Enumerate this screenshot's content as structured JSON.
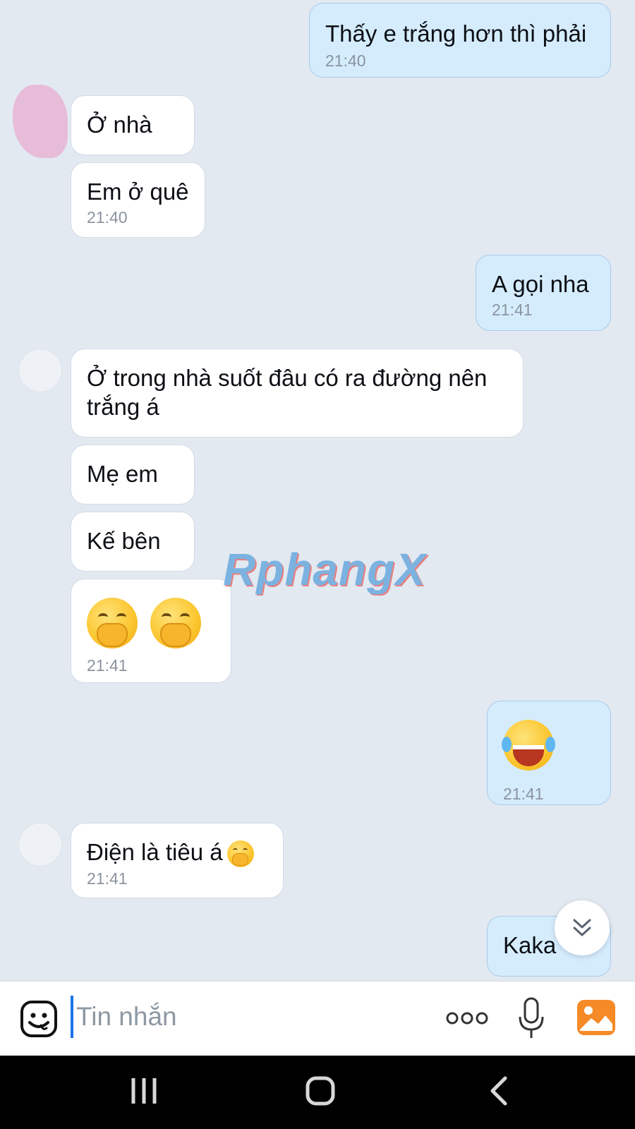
{
  "messages": [
    {
      "side": "out",
      "text": "Thấy e trắng hơn thì phải",
      "time": "21:40"
    },
    {
      "side": "in",
      "text": "Ở nhà",
      "time": ""
    },
    {
      "side": "in",
      "text": "Em ở quê",
      "time": "21:40"
    },
    {
      "side": "out",
      "text": "A gọi nha",
      "time": "21:41"
    },
    {
      "side": "in",
      "text": "Ở trong nhà suốt đâu có ra đường nên trắng á",
      "time": ""
    },
    {
      "side": "in",
      "text": "Mẹ em",
      "time": ""
    },
    {
      "side": "in",
      "text": "Kế bên",
      "time": ""
    },
    {
      "side": "in",
      "text": "",
      "emoji": "hand-over-mouth-emoji x2",
      "time": "21:41"
    },
    {
      "side": "out",
      "text": "",
      "emoji": "tears-of-joy-emoji",
      "time": "21:41"
    },
    {
      "side": "in",
      "text": "Điện là tiêu á",
      "emoji": "hand-over-mouth-emoji",
      "time": "21:41"
    },
    {
      "side": "out",
      "text": "Kaka",
      "time": ""
    }
  ],
  "watermark": "RphangX",
  "input": {
    "placeholder": "Tin nhắn"
  },
  "toolbar": {
    "emoji_icon": "sticker-face-icon",
    "more_icon": "more-dots-icon",
    "mic_icon": "microphone-icon",
    "photo_icon": "gallery-icon"
  },
  "navbar": {
    "recents_icon": "recents-icon",
    "home_icon": "home-icon",
    "back_icon": "back-icon"
  },
  "colors": {
    "incoming_bubble": "#ffffff",
    "outgoing_bubble": "#d5ecfd",
    "background": "#e2e9f1",
    "accent": "#f58a26"
  }
}
